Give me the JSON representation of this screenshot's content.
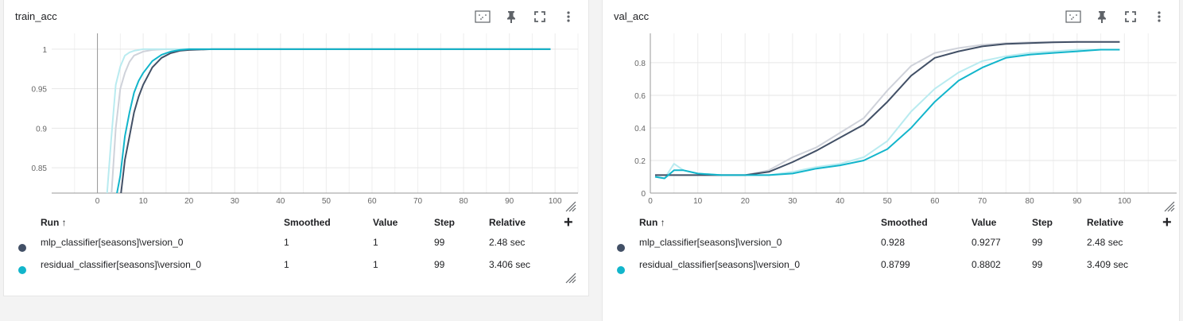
{
  "colors": {
    "mlp": "#425066",
    "mlp_raw": "#cfd2da",
    "residual": "#12b5cb",
    "residual_raw": "#b9ebf0",
    "grid": "#e6e6e6",
    "axis": "#999999"
  },
  "icons": {
    "data_selection": "fit-domain-icon",
    "pin": "pin-icon",
    "fullscreen": "fullscreen-icon",
    "more": "more-vert-icon",
    "add": "add-icon",
    "resize": "resize-handle-icon"
  },
  "table_headers": {
    "run": "Run",
    "run_sort": "↑",
    "smoothed": "Smoothed",
    "value": "Value",
    "step": "Step",
    "relative": "Relative"
  },
  "add_label": "+",
  "charts": [
    {
      "title": "train_acc",
      "runs": [
        {
          "name": "mlp_classifier[seasons]\\version_0",
          "smoothed": "1",
          "value": "1",
          "step": "99",
          "relative": "2.48 sec"
        },
        {
          "name": "residual_classifier[seasons]\\version_0",
          "smoothed": "1",
          "value": "1",
          "step": "99",
          "relative": "3.406 sec"
        }
      ]
    },
    {
      "title": "val_acc",
      "runs": [
        {
          "name": "mlp_classifier[seasons]\\version_0",
          "smoothed": "0.928",
          "value": "0.9277",
          "step": "99",
          "relative": "2.48 sec"
        },
        {
          "name": "residual_classifier[seasons]\\version_0",
          "smoothed": "0.8799",
          "value": "0.8802",
          "step": "99",
          "relative": "3.409 sec"
        }
      ]
    }
  ],
  "chart_data": [
    {
      "type": "line",
      "title": "train_acc",
      "xlabel": "",
      "ylabel": "",
      "xlim": [
        -10,
        105
      ],
      "ylim": [
        0.818,
        1.02
      ],
      "xticks": [
        0,
        10,
        20,
        30,
        40,
        50,
        60,
        70,
        80,
        90,
        100
      ],
      "yticks": [
        0.85,
        0.9,
        0.95,
        1
      ],
      "ytick_labels": [
        "0.85",
        "0.9",
        "0.95",
        "1"
      ],
      "grid": true,
      "series": [
        {
          "name": "mlp_classifier[seasons]\\version_0 (raw)",
          "color_key": "mlp_raw",
          "x": [
            3,
            4,
            5,
            6,
            7,
            8,
            10,
            12,
            15,
            20,
            25,
            99
          ],
          "y": [
            0.81,
            0.9,
            0.95,
            0.97,
            0.984,
            0.992,
            0.997,
            0.999,
            1,
            1,
            1,
            1
          ]
        },
        {
          "name": "residual_classifier[seasons]\\version_0 (raw)",
          "color_key": "residual_raw",
          "x": [
            2,
            3,
            4,
            5,
            6,
            7,
            8,
            10,
            12,
            15,
            99
          ],
          "y": [
            0.81,
            0.885,
            0.955,
            0.978,
            0.992,
            0.996,
            0.998,
            1,
            1,
            1,
            1
          ]
        },
        {
          "name": "mlp_classifier[seasons]\\version_0",
          "color_key": "mlp",
          "x": [
            5,
            6,
            7,
            8,
            9,
            10,
            12,
            14,
            16,
            18,
            20,
            25,
            99
          ],
          "y": [
            0.81,
            0.86,
            0.89,
            0.92,
            0.94,
            0.955,
            0.977,
            0.989,
            0.995,
            0.998,
            0.999,
            1,
            1
          ]
        },
        {
          "name": "residual_classifier[seasons]\\version_0",
          "color_key": "residual",
          "x": [
            4,
            5,
            6,
            7,
            8,
            9,
            10,
            12,
            14,
            16,
            18,
            20,
            25,
            99
          ],
          "y": [
            0.81,
            0.84,
            0.89,
            0.92,
            0.945,
            0.96,
            0.97,
            0.985,
            0.993,
            0.997,
            0.999,
            1,
            1,
            1
          ]
        }
      ]
    },
    {
      "type": "line",
      "title": "val_acc",
      "xlabel": "",
      "ylabel": "",
      "xlim": [
        0,
        111
      ],
      "ylim": [
        0,
        0.98
      ],
      "xticks": [
        0,
        10,
        20,
        30,
        40,
        50,
        60,
        70,
        80,
        90,
        100
      ],
      "yticks": [
        0,
        0.2,
        0.4,
        0.6,
        0.8
      ],
      "ytick_labels": [
        "0",
        "0.2",
        "0.4",
        "0.6",
        "0.8"
      ],
      "grid": true,
      "series": [
        {
          "name": "mlp_classifier[seasons]\\version_0 (raw)",
          "color_key": "mlp_raw",
          "x": [
            1,
            10,
            20,
            25,
            30,
            35,
            40,
            45,
            50,
            55,
            60,
            65,
            70,
            75,
            80,
            85,
            90,
            99
          ],
          "y": [
            0.11,
            0.11,
            0.11,
            0.14,
            0.22,
            0.28,
            0.37,
            0.46,
            0.63,
            0.78,
            0.86,
            0.89,
            0.91,
            0.92,
            0.925,
            0.928,
            0.928,
            0.928
          ]
        },
        {
          "name": "residual_classifier[seasons]\\version_0 (raw)",
          "color_key": "residual_raw",
          "x": [
            1,
            3,
            5,
            7,
            10,
            15,
            20,
            25,
            30,
            35,
            40,
            45,
            50,
            55,
            60,
            65,
            70,
            75,
            80,
            85,
            90,
            95,
            99
          ],
          "y": [
            0.1,
            0.09,
            0.18,
            0.14,
            0.12,
            0.11,
            0.11,
            0.11,
            0.13,
            0.16,
            0.18,
            0.22,
            0.32,
            0.5,
            0.64,
            0.74,
            0.81,
            0.84,
            0.86,
            0.87,
            0.88,
            0.88,
            0.88
          ]
        },
        {
          "name": "mlp_classifier[seasons]\\version_0",
          "color_key": "mlp",
          "x": [
            1,
            10,
            20,
            25,
            30,
            35,
            40,
            45,
            50,
            55,
            60,
            65,
            70,
            75,
            80,
            85,
            90,
            99
          ],
          "y": [
            0.11,
            0.11,
            0.11,
            0.13,
            0.19,
            0.26,
            0.34,
            0.42,
            0.56,
            0.72,
            0.83,
            0.87,
            0.9,
            0.915,
            0.92,
            0.925,
            0.928,
            0.928
          ]
        },
        {
          "name": "residual_classifier[seasons]\\version_0",
          "color_key": "residual",
          "x": [
            1,
            3,
            5,
            7,
            10,
            15,
            20,
            25,
            30,
            35,
            40,
            45,
            50,
            55,
            60,
            65,
            70,
            75,
            80,
            85,
            90,
            95,
            99
          ],
          "y": [
            0.1,
            0.09,
            0.14,
            0.14,
            0.12,
            0.11,
            0.11,
            0.11,
            0.12,
            0.15,
            0.17,
            0.2,
            0.27,
            0.4,
            0.56,
            0.69,
            0.77,
            0.83,
            0.85,
            0.86,
            0.87,
            0.88,
            0.88
          ]
        }
      ]
    }
  ]
}
